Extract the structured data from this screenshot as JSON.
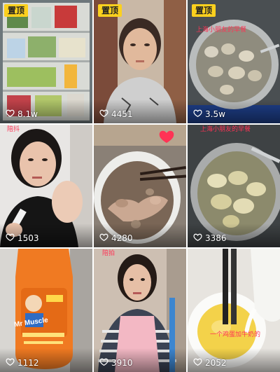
{
  "tiles": [
    {
      "pinned_label": "置顶",
      "caption": "",
      "likes": "8.1w"
    },
    {
      "pinned_label": "置顶",
      "caption": "",
      "likes": "4451"
    },
    {
      "pinned_label": "置顶",
      "caption": "上海小朋友的早餐",
      "likes": "3.5w"
    },
    {
      "pinned_label": "",
      "caption": "陪抖",
      "likes": "1503"
    },
    {
      "pinned_label": "",
      "caption": "",
      "likes": "4280"
    },
    {
      "pinned_label": "",
      "caption": "上海小朋友的早餐",
      "likes": "3386"
    },
    {
      "pinned_label": "",
      "caption": "",
      "likes": "1112"
    },
    {
      "pinned_label": "",
      "caption": "陪拍",
      "likes": "3910"
    },
    {
      "pinned_label": "",
      "caption": "一个鸡蛋加牛奶的",
      "likes": "2052"
    }
  ],
  "product_label": {
    "brand": "Mr Muscle"
  },
  "colors": {
    "pinned_bg": "#fbd01e",
    "caption": "#ff3355",
    "likes_text": "#ffffff"
  }
}
